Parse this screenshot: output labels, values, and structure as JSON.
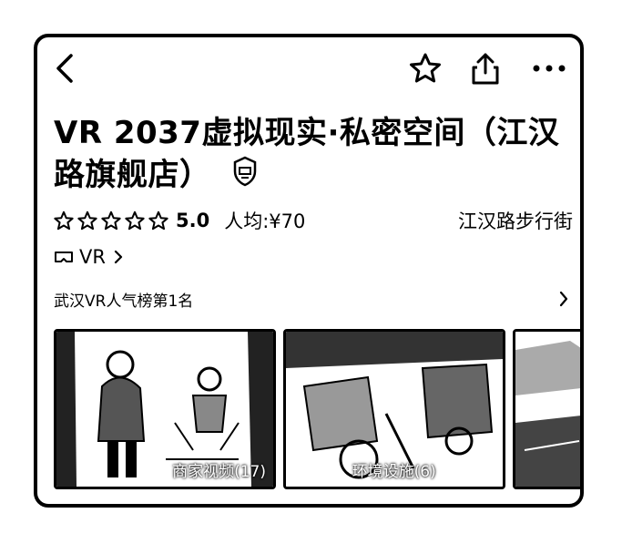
{
  "header": {
    "title": "VR 2037虚拟现实·私密空间（江汉路旗舰店）"
  },
  "meta": {
    "rating_value": "5.0",
    "avg_price": "人均:¥70",
    "area": "江汉路步行街",
    "stars_count": 5
  },
  "tag": {
    "label": "VR"
  },
  "rank": {
    "label": "武汉VR人气榜第1名"
  },
  "gallery": {
    "items": [
      {
        "caption": "商家视频(17)"
      },
      {
        "caption": "环境设施(6)"
      },
      {
        "caption": ""
      }
    ]
  },
  "icons": {
    "back": "chevron-left-icon",
    "favorite": "star-outline-icon",
    "share": "share-icon",
    "more": "more-dots-icon",
    "vr": "vr-headset-icon",
    "badge": "flagship-badge-icon"
  }
}
